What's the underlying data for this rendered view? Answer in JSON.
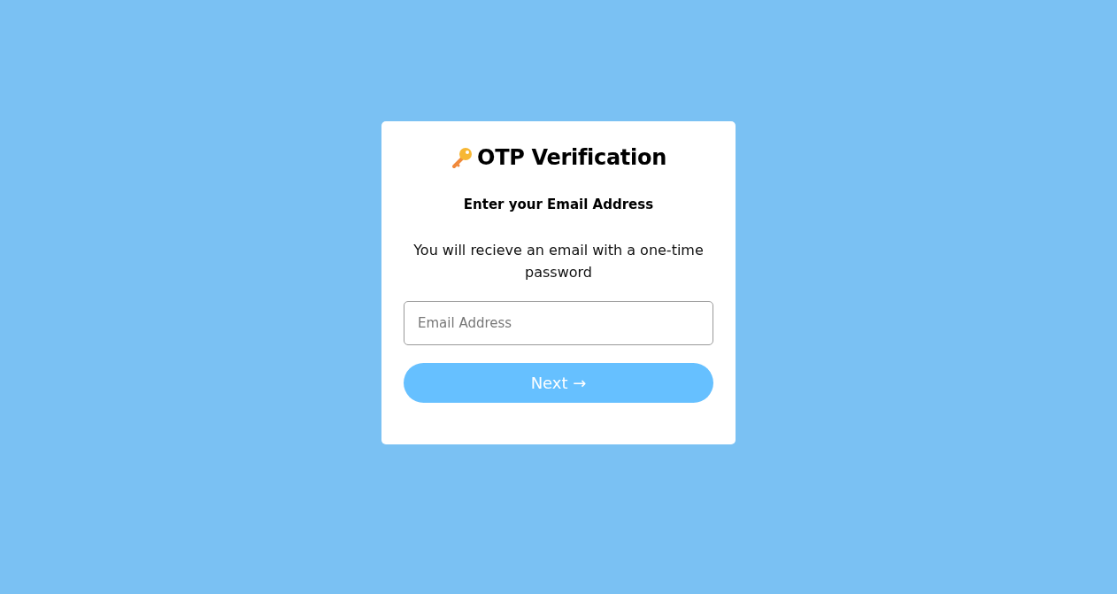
{
  "card": {
    "title": "OTP Verification",
    "subtitle": "Enter your Email Address",
    "description": "You will recieve an email with a one-time password",
    "email_field": {
      "placeholder": "Email Address"
    },
    "next_button": {
      "label": "Next →",
      "disabled": true
    }
  }
}
